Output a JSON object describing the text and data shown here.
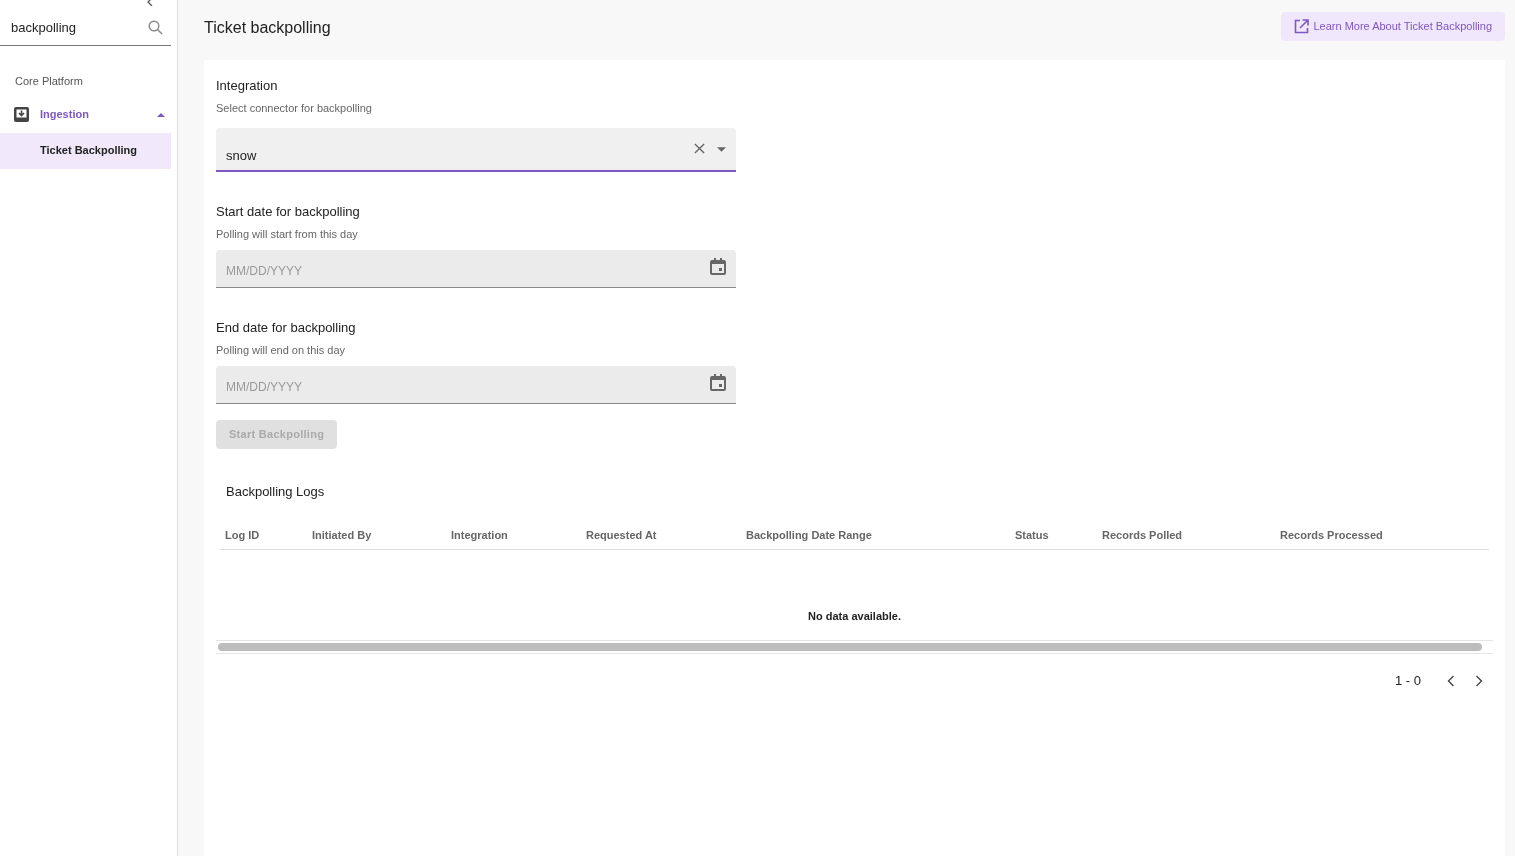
{
  "sidebar": {
    "search": {
      "value": "backpolling"
    },
    "section": "Core Platform",
    "groups": [
      {
        "label": "Ingestion",
        "expanded": true,
        "selected": true,
        "children": [
          {
            "label": "Ticket Backpolling",
            "selected": true
          }
        ]
      }
    ]
  },
  "page": {
    "title": "Ticket backpolling",
    "learn_more": "Learn More About Ticket Backpolling"
  },
  "form": {
    "fields": [
      {
        "kind": "select",
        "label": "Integration",
        "hint": "Select connector for backpolling",
        "value": "snow",
        "focused": true
      },
      {
        "kind": "date",
        "label": "Start date for backpolling",
        "hint": "Polling will start from this day",
        "placeholder": "MM/DD/YYYY",
        "focused": false
      },
      {
        "kind": "date",
        "label": "End date for backpolling",
        "hint": "Polling will end on this day",
        "placeholder": "MM/DD/YYYY",
        "focused": false
      }
    ],
    "submit": {
      "label": "Start Backpolling",
      "disabled": true
    }
  },
  "logs": {
    "title": "Backpolling Logs",
    "columns": [
      "Log ID",
      "Initiated By",
      "Integration",
      "Requested At",
      "Backpolling Date Range",
      "Status",
      "Records Polled",
      "Records Processed"
    ],
    "empty": "No data available.",
    "pagination": "1 - 0"
  }
}
